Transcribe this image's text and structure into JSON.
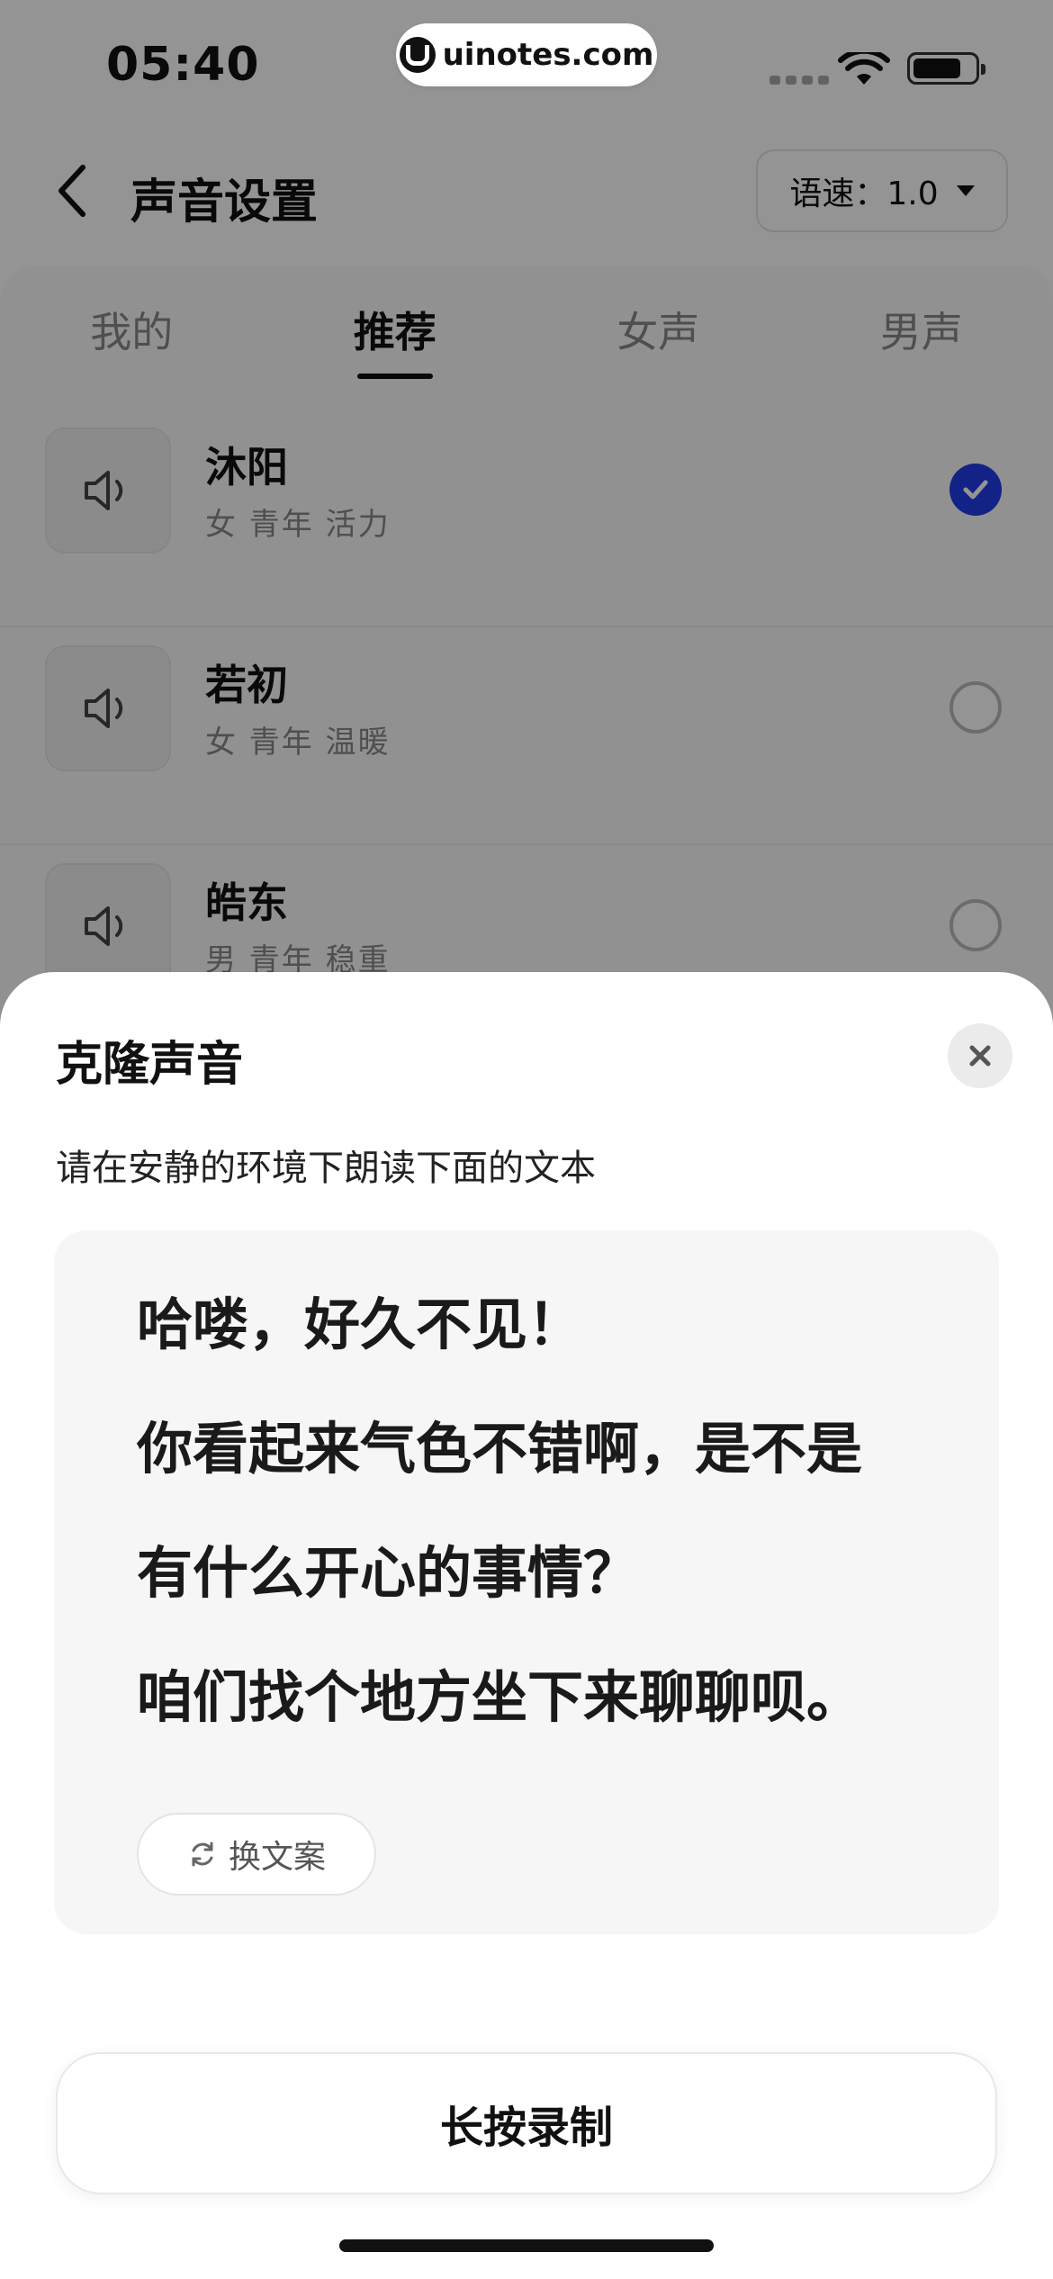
{
  "status_bar": {
    "time": "05:40",
    "watermark": "uinotes.com"
  },
  "header": {
    "title": "声音设置",
    "speed_label": "语速：1.0"
  },
  "tabs": [
    {
      "label": "我的",
      "active": false
    },
    {
      "label": "推荐",
      "active": true
    },
    {
      "label": "女声",
      "active": false
    },
    {
      "label": "男声",
      "active": false
    }
  ],
  "voices": [
    {
      "name": "沐阳",
      "tags": "女 青年 活力",
      "selected": true
    },
    {
      "name": "若初",
      "tags": "女 青年 温暖",
      "selected": false
    },
    {
      "name": "皓东",
      "tags": "男 青年 稳重",
      "selected": false
    }
  ],
  "sheet": {
    "title": "克隆声音",
    "subtitle": "请在安静的环境下朗读下面的文本",
    "script_lines": [
      "哈喽，好久不见！",
      "你看起来气色不错啊，是不是",
      "有什么开心的事情？",
      "咱们找个地方坐下来聊聊呗。"
    ],
    "change_text_label": "换文案",
    "record_label": "长按录制"
  },
  "colors": {
    "accent": "#1f3ce8",
    "overlay": "rgba(0,0,0,0.42)"
  }
}
